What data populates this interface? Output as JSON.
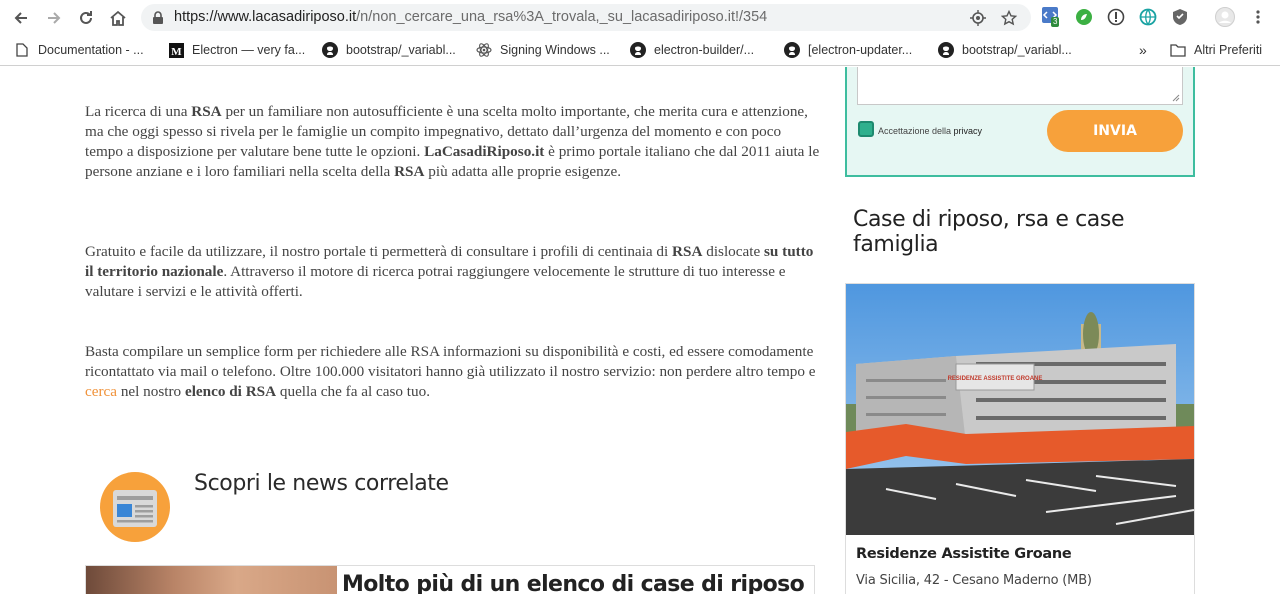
{
  "browser": {
    "url_host": "https://www.lacasadiriposo.it",
    "url_path": "/n/non_cercare_una_rsa%3A_trovala,_su_lacasadiriposo.it!/354",
    "extension_badge": "3",
    "bookmarks": [
      {
        "label": "Documentation - ...",
        "icon": "document-icon"
      },
      {
        "label": "Electron — very fa...",
        "icon": "medium-icon"
      },
      {
        "label": "bootstrap/_variabl...",
        "icon": "github-icon"
      },
      {
        "label": "Signing Windows ...",
        "icon": "electron-icon"
      },
      {
        "label": "electron-builder/...",
        "icon": "github-icon"
      },
      {
        "label": "[electron-updater...",
        "icon": "github-icon"
      },
      {
        "label": "bootstrap/_variabl...",
        "icon": "github-icon"
      }
    ],
    "more_bookmarks": "»",
    "other_bookmarks": "Altri Preferiti"
  },
  "article": {
    "p1": [
      {
        "t": "La ricerca di una "
      },
      {
        "t": "RSA",
        "b": true
      },
      {
        "t": " per un familiare non autosufficiente è una scelta molto importante, che merita cura e attenzione, ma che oggi spesso si rivela per le famiglie un compito impegnativo, dettato dall’urgenza del momento e con poco tempo a disposizione per valutare bene tutte le opzioni. "
      },
      {
        "t": "LaCasadiRiposo.it",
        "b": true
      },
      {
        "t": " è primo portale italiano che dal 2011 aiuta le persone anziane e i loro familiari nella scelta della "
      },
      {
        "t": "RSA",
        "b": true
      },
      {
        "t": " più adatta alle proprie esigenze."
      }
    ],
    "p2": [
      {
        "t": "Gratuito e facile da utilizzare, il nostro portale ti permetterà di consultare i profili di centinaia di "
      },
      {
        "t": "RSA",
        "b": true
      },
      {
        "t": " dislocate "
      },
      {
        "t": "su tutto il territorio nazionale",
        "b": true
      },
      {
        "t": ". Attraverso il motore di ricerca potrai raggiungere velocemente le strutture di tuo interesse e valutare i servizi e le attività offerti."
      }
    ],
    "p3": [
      {
        "t": "Basta compilare un semplice form per richiedere alle RSA informazioni su disponibilità e costi, ed essere comodamente ricontattato via mail o telefono. Oltre 100.000 visitatori hanno già utilizzato il nostro servizio: non perdere altro tempo e "
      },
      {
        "t": "cerca",
        "link": true
      },
      {
        "t": " nel nostro "
      },
      {
        "t": "elenco di RSA",
        "b": true
      },
      {
        "t": " quella che fa al caso tuo."
      }
    ]
  },
  "related": {
    "title": "Scopri le news correlate",
    "first_news_title": "Molto più di un elenco di case di riposo"
  },
  "contact_form": {
    "privacy_prefix": "Accettazione della ",
    "privacy_link": "privacy",
    "submit_label": "INVIA"
  },
  "sidebar": {
    "title": "Case di riposo, rsa e case famiglia",
    "residence": {
      "name": "Residenze Assistite Groane",
      "address": "Via Sicilia, 42 - Cesano Maderno (MB)",
      "building_sign": "RESIDENZE ASSISTITE GROANE"
    }
  },
  "colors": {
    "accent_orange": "#f7a13b",
    "form_border_teal": "#3ebd9f",
    "form_bg": "#e6f7f3",
    "link_orange": "#f0923a"
  }
}
